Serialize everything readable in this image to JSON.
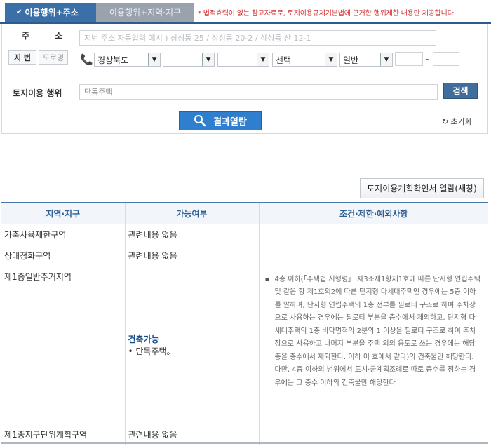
{
  "tabs": {
    "active_label": "이용행위+주소",
    "active_check": "✔",
    "inactive_label": "이용행위+지역·지구"
  },
  "notice": "* 법적효력이 없는 참고자료로, 토지이용규제기본법에 근거한 행위제한 내용만 제공합니다.",
  "form": {
    "address_label": "주 소",
    "address_placeholder": "지번 주소 자동입력 예시 ) 삼성동 25  /  삼성동 20-2  /  삼성동 산 12-1",
    "jibun_btn": "지 번",
    "road_btn": "도로명",
    "province": "경상북도",
    "city": "",
    "town": "",
    "village": "선택",
    "land_type": "일반",
    "bunji_main": "",
    "bunji_sub": "",
    "dash": "-",
    "usage_label": "토지이용 행위",
    "usage_value": "단독주택",
    "search_btn": "검색",
    "result_btn": "결과열람",
    "reset_btn": "초기화"
  },
  "plan_btn": "토지이용계획확인서 열람(새창)",
  "table": {
    "headers": [
      "지역·지구",
      "가능여부",
      "조건·제한·예외사항"
    ],
    "rows": [
      {
        "zone": "가축사육제한구역",
        "status": "관련내용 없음"
      },
      {
        "zone": "상대정화구역",
        "status": "관련내용 없음"
      },
      {
        "zone": "제1종일반주거지역",
        "status_title": "건축가능",
        "status_detail": "• 단독주택。",
        "condition": "4층 이하(「주택법 시행령」 제3조제1항제1호에 따른 단지형 연립주택 및 같은 항 제1호의2에 따른 단지형 다세대주택인 경우에는 5층 이하를 말하며, 단지형 연립주택의 1층 전부를 필로티 구조로 하여 주차장으로 사용하는 경우에는 필로티 부분을 층수에서 제외하고, 단지형 다세대주택의 1층 바닥면적의 2분의 1 이상을 필로티 구조로 하여 주차장으로 사용하고 나머지 부분을 주택 외의 용도로 쓰는 경우에는 해당 층을 층수에서 제외한다. 이하 이 호에서 같다)의 건축물만 해당한다. 다만, 4층 이하의 범위에서 도시·군계획조례로 따로 층수를 정하는 경우에는 그 층수 이하의 건축물만 해당한다"
      },
      {
        "zone": "제1종지구단위계획구역",
        "status": "관련내용 없음"
      }
    ]
  },
  "colors": {
    "accent": "#3b6fa8",
    "result_button": "#2f7fce",
    "notice": "#d62b2b",
    "header_text": "#2e5f93"
  }
}
